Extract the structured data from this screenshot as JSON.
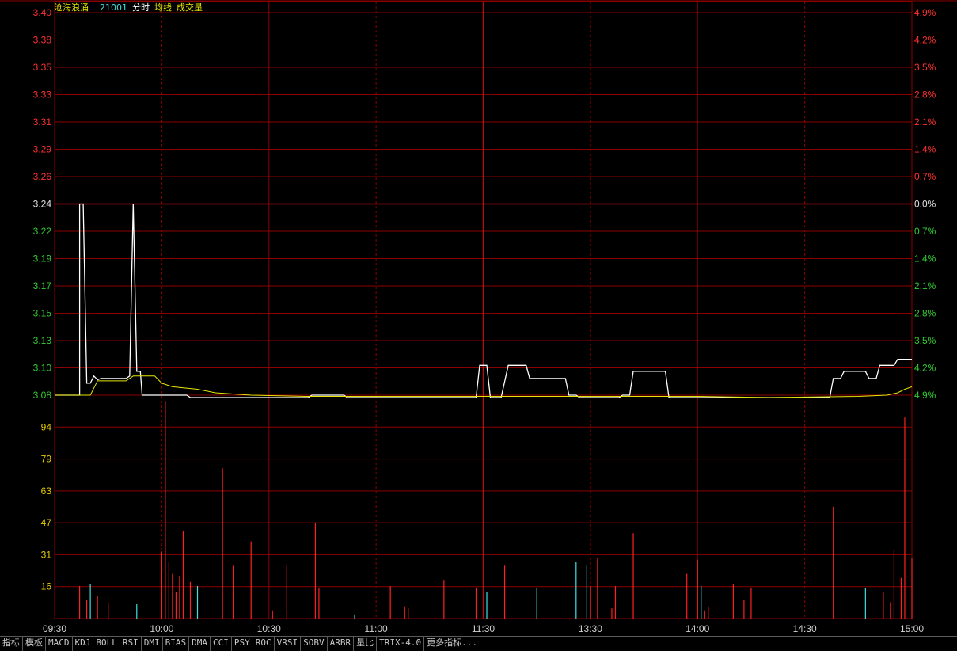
{
  "header": {
    "stock_name": "沧海浪涌",
    "stock_code": "21001",
    "legend_items": [
      "分时",
      "均线",
      "成交量"
    ]
  },
  "colors": {
    "background": "#000000",
    "grid": "#8b0000",
    "up": "#ff3030",
    "down": "#33cc33",
    "neutral": "#e0e0e0",
    "price_line": "#ffffff",
    "avg_line": "#e6e600",
    "volume_up": "#ff2020",
    "volume_down": "#40e0e0",
    "volume_axis": "#e6c800",
    "time_label": "#d2d2d2"
  },
  "tabs": [
    "指标",
    "模板",
    "MACD",
    "KDJ",
    "BOLL",
    "RSI",
    "DMI",
    "BIAS",
    "DMA",
    "CCI",
    "PSY",
    "ROC",
    "VRSI",
    "SOBV",
    "ARBR",
    "量比",
    "TRIX-4.0",
    "更多指标..."
  ],
  "chart_data": {
    "type": "line",
    "prev_close": 3.24,
    "price_axis": {
      "ylim": [
        3.08,
        3.4
      ],
      "left_ticks": [
        "3.40",
        "3.38",
        "3.35",
        "3.33",
        "3.31",
        "3.29",
        "3.26",
        "3.24",
        "3.22",
        "3.19",
        "3.17",
        "3.15",
        "3.13",
        "3.10",
        "3.08"
      ],
      "right_ticks": [
        "4.9%",
        "4.2%",
        "3.5%",
        "2.8%",
        "2.1%",
        "1.4%",
        "0.7%",
        "0.0%",
        "0.7%",
        "1.4%",
        "2.1%",
        "2.8%",
        "3.5%",
        "4.2%",
        "4.9%"
      ],
      "tick_direction": [
        "up",
        "up",
        "up",
        "up",
        "up",
        "up",
        "up",
        "flat",
        "down",
        "down",
        "down",
        "down",
        "down",
        "down",
        "down"
      ]
    },
    "volume_axis": {
      "ylim": [
        0,
        110
      ],
      "ticks": [
        "94",
        "79",
        "63",
        "47",
        "31",
        "16"
      ]
    },
    "time_axis": {
      "labels": [
        "09:30",
        "10:00",
        "10:30",
        "11:00",
        "11:30",
        "13:30",
        "14:00",
        "14:30",
        "15:00"
      ],
      "label_minutes": [
        0,
        30,
        60,
        90,
        120,
        150,
        180,
        210,
        240
      ]
    },
    "series": [
      {
        "key": "price",
        "points": [
          [
            0,
            3.08
          ],
          [
            7,
            3.08
          ],
          [
            7,
            3.24
          ],
          [
            8,
            3.24
          ],
          [
            9,
            3.09
          ],
          [
            10,
            3.09
          ],
          [
            11,
            3.096
          ],
          [
            12,
            3.093
          ],
          [
            13,
            3.094
          ],
          [
            20,
            3.094
          ],
          [
            21,
            3.096
          ],
          [
            22,
            3.24
          ],
          [
            23,
            3.1
          ],
          [
            24,
            3.1
          ],
          [
            24.5,
            3.08
          ],
          [
            37,
            3.08
          ],
          [
            38,
            3.078
          ],
          [
            71,
            3.078
          ],
          [
            72,
            3.08
          ],
          [
            81,
            3.08
          ],
          [
            82,
            3.078
          ],
          [
            118,
            3.078
          ],
          [
            119,
            3.105
          ],
          [
            121,
            3.105
          ],
          [
            122,
            3.078
          ],
          [
            125,
            3.078
          ],
          [
            127,
            3.105
          ],
          [
            132,
            3.105
          ],
          [
            133,
            3.094
          ],
          [
            143,
            3.094
          ],
          [
            144,
            3.08
          ],
          [
            146,
            3.08
          ],
          [
            147,
            3.078
          ],
          [
            158,
            3.078
          ],
          [
            159,
            3.08
          ],
          [
            161,
            3.08
          ],
          [
            162,
            3.1
          ],
          [
            171,
            3.1
          ],
          [
            172,
            3.078
          ],
          [
            217,
            3.078
          ],
          [
            218,
            3.094
          ],
          [
            220,
            3.094
          ],
          [
            221,
            3.1
          ],
          [
            227,
            3.1
          ],
          [
            228,
            3.094
          ],
          [
            230,
            3.094
          ],
          [
            231,
            3.105
          ],
          [
            235,
            3.105
          ],
          [
            236,
            3.11
          ],
          [
            240,
            3.11
          ]
        ]
      },
      {
        "key": "average",
        "points": [
          [
            0,
            3.08
          ],
          [
            10,
            3.08
          ],
          [
            12,
            3.092
          ],
          [
            20,
            3.092
          ],
          [
            22,
            3.096
          ],
          [
            28,
            3.096
          ],
          [
            30,
            3.09
          ],
          [
            33,
            3.087
          ],
          [
            40,
            3.085
          ],
          [
            45,
            3.082
          ],
          [
            55,
            3.08
          ],
          [
            70,
            3.079
          ],
          [
            100,
            3.079
          ],
          [
            130,
            3.079
          ],
          [
            160,
            3.079
          ],
          [
            180,
            3.079
          ],
          [
            200,
            3.078
          ],
          [
            225,
            3.079
          ],
          [
            233,
            3.08
          ],
          [
            236,
            3.082
          ],
          [
            238,
            3.085
          ],
          [
            240,
            3.087
          ]
        ]
      }
    ],
    "volume_bars": [
      {
        "t": 7,
        "v": 16,
        "dir": "up"
      },
      {
        "t": 9,
        "v": 9,
        "dir": "up"
      },
      {
        "t": 10,
        "v": 17,
        "dir": "down"
      },
      {
        "t": 12,
        "v": 11,
        "dir": "up"
      },
      {
        "t": 15,
        "v": 8,
        "dir": "up"
      },
      {
        "t": 23,
        "v": 7,
        "dir": "down"
      },
      {
        "t": 30,
        "v": 33,
        "dir": "up"
      },
      {
        "t": 31,
        "v": 107,
        "dir": "up"
      },
      {
        "t": 32,
        "v": 28,
        "dir": "up"
      },
      {
        "t": 33,
        "v": 22,
        "dir": "up"
      },
      {
        "t": 34,
        "v": 13,
        "dir": "up"
      },
      {
        "t": 35,
        "v": 21,
        "dir": "up"
      },
      {
        "t": 36,
        "v": 43,
        "dir": "up"
      },
      {
        "t": 38,
        "v": 18,
        "dir": "up"
      },
      {
        "t": 40,
        "v": 16,
        "dir": "down"
      },
      {
        "t": 47,
        "v": 74,
        "dir": "up"
      },
      {
        "t": 50,
        "v": 26,
        "dir": "up"
      },
      {
        "t": 55,
        "v": 38,
        "dir": "up"
      },
      {
        "t": 61,
        "v": 4,
        "dir": "up"
      },
      {
        "t": 65,
        "v": 26,
        "dir": "up"
      },
      {
        "t": 73,
        "v": 47,
        "dir": "up"
      },
      {
        "t": 74,
        "v": 15,
        "dir": "up"
      },
      {
        "t": 84,
        "v": 2,
        "dir": "down"
      },
      {
        "t": 94,
        "v": 16,
        "dir": "up"
      },
      {
        "t": 98,
        "v": 6,
        "dir": "up"
      },
      {
        "t": 99,
        "v": 5,
        "dir": "up"
      },
      {
        "t": 109,
        "v": 19,
        "dir": "up"
      },
      {
        "t": 118,
        "v": 15,
        "dir": "up"
      },
      {
        "t": 121,
        "v": 13,
        "dir": "down"
      },
      {
        "t": 126,
        "v": 26,
        "dir": "up"
      },
      {
        "t": 135,
        "v": 15,
        "dir": "down"
      },
      {
        "t": 146,
        "v": 28,
        "dir": "down"
      },
      {
        "t": 149,
        "v": 26,
        "dir": "down"
      },
      {
        "t": 150,
        "v": 16,
        "dir": "up"
      },
      {
        "t": 152,
        "v": 30,
        "dir": "up"
      },
      {
        "t": 156,
        "v": 5,
        "dir": "up"
      },
      {
        "t": 157,
        "v": 16,
        "dir": "up"
      },
      {
        "t": 162,
        "v": 42,
        "dir": "up"
      },
      {
        "t": 177,
        "v": 22,
        "dir": "up"
      },
      {
        "t": 180,
        "v": 29,
        "dir": "up"
      },
      {
        "t": 181,
        "v": 16,
        "dir": "down"
      },
      {
        "t": 182,
        "v": 4,
        "dir": "up"
      },
      {
        "t": 183,
        "v": 6,
        "dir": "up"
      },
      {
        "t": 190,
        "v": 17,
        "dir": "up"
      },
      {
        "t": 193,
        "v": 9,
        "dir": "up"
      },
      {
        "t": 195,
        "v": 15,
        "dir": "up"
      },
      {
        "t": 218,
        "v": 55,
        "dir": "up"
      },
      {
        "t": 227,
        "v": 15,
        "dir": "down"
      },
      {
        "t": 232,
        "v": 13,
        "dir": "up"
      },
      {
        "t": 234,
        "v": 8,
        "dir": "up"
      },
      {
        "t": 235,
        "v": 34,
        "dir": "up"
      },
      {
        "t": 237,
        "v": 20,
        "dir": "up"
      },
      {
        "t": 238,
        "v": 99,
        "dir": "up"
      },
      {
        "t": 240,
        "v": 30,
        "dir": "up"
      }
    ]
  }
}
